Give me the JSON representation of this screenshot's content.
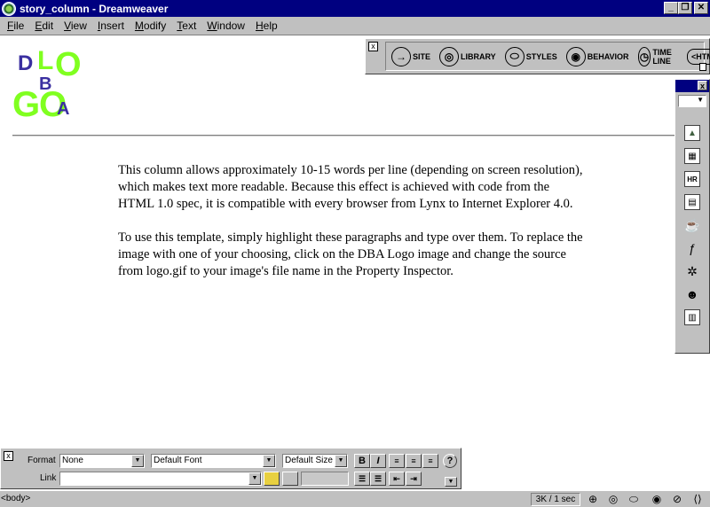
{
  "window": {
    "title": "story_column - Dreamweaver",
    "min": "_",
    "max": "❐",
    "close": "✕"
  },
  "menu": [
    {
      "accel": "F",
      "rest": "ile"
    },
    {
      "accel": "E",
      "rest": "dit"
    },
    {
      "accel": "V",
      "rest": "iew"
    },
    {
      "accel": "I",
      "rest": "nsert"
    },
    {
      "accel": "M",
      "rest": "odify"
    },
    {
      "accel": "T",
      "rest": "ext"
    },
    {
      "accel": "W",
      "rest": "indow"
    },
    {
      "accel": "H",
      "rest": "elp"
    }
  ],
  "logo": {
    "letters": [
      "D",
      "L",
      "O",
      "B",
      "G",
      "O",
      "A"
    ],
    "colors": {
      "green": "#80ff20",
      "blue": "#3a2fa0"
    }
  },
  "document": {
    "paragraphs": [
      "This column allows approximately 10-15 words per line (depending on screen resolution), which makes text more readable. Because this effect is achieved with code from the HTML 1.0 spec, it is compatible with every browser from Lynx to Internet Explorer 4.0.",
      "To use this template, simply highlight these paragraphs and type over them. To replace the image with one of your choosing, click on the DBA Logo image and change the source from logo.gif to your image's file name in the Property Inspector."
    ]
  },
  "launcher": {
    "close": "x",
    "buttons": [
      {
        "label": "SITE",
        "icon": "site-icon",
        "glyph": "→"
      },
      {
        "label": "LIBRARY",
        "icon": "library-icon",
        "glyph": "◎"
      },
      {
        "label": "STYLES",
        "icon": "styles-icon",
        "glyph": "⬭"
      },
      {
        "label": "BEHAVIOR",
        "icon": "behavior-icon",
        "glyph": "◉"
      },
      {
        "label": "TIME LINE",
        "icon": "timeline-icon",
        "glyph": "◷"
      },
      {
        "label": "<HTML>",
        "icon": "html-icon",
        "glyph": ""
      }
    ]
  },
  "objects_palette": {
    "close": "x",
    "icons": [
      {
        "name": "image-icon",
        "glyph": "▲"
      },
      {
        "name": "table-icon",
        "glyph": "▦"
      },
      {
        "name": "horizontal-rule-icon",
        "glyph": "HR"
      },
      {
        "name": "layer-icon",
        "glyph": "▤"
      },
      {
        "name": "plugin-icon",
        "glyph": "☕"
      },
      {
        "name": "flash-icon",
        "glyph": "ƒ"
      },
      {
        "name": "applet-icon",
        "glyph": "✲"
      },
      {
        "name": "activex-icon",
        "glyph": "☻"
      },
      {
        "name": "form-icon",
        "glyph": "▥"
      }
    ]
  },
  "property_inspector": {
    "close": "x",
    "format_label": "Format",
    "format_value": "None",
    "font_value": "Default Font",
    "size_value": "Default Size",
    "link_label": "Link",
    "link_value": "",
    "bold": "B",
    "italic": "I",
    "help": "?"
  },
  "status": {
    "tag": "<body>",
    "download": "3K / 1 sec"
  }
}
